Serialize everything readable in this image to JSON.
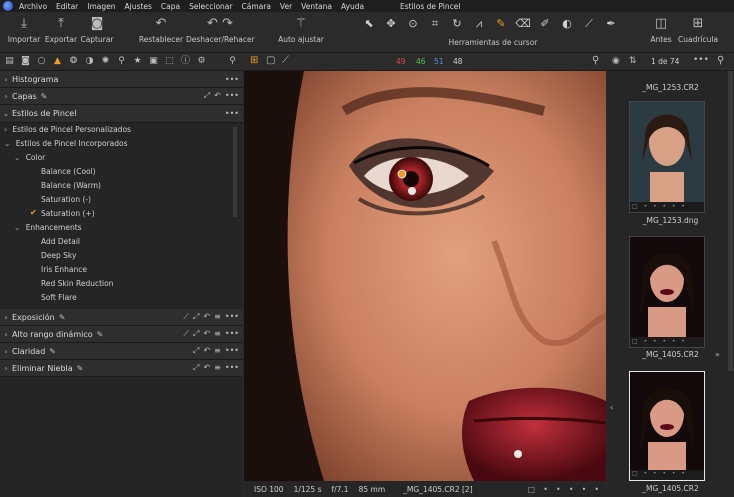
{
  "menubar": {
    "items": [
      "Archivo",
      "Editar",
      "Imagen",
      "Ajustes",
      "Capa",
      "Seleccionar",
      "Cámara",
      "Ver",
      "Ventana",
      "Ayuda"
    ],
    "window_title": "Estilos de Pincel"
  },
  "toolbar": {
    "importar": "Importar",
    "exportar": "Exportar",
    "capturar": "Capturar",
    "restablecer": "Restablecer",
    "deshacer": "Deshacer/Rehacer",
    "auto": "Auto ajustar",
    "cursor_tools": "Herramientas de cursor",
    "antes": "Antes",
    "cuadricula": "Cuadrícula"
  },
  "left_panel": {
    "histograma": "Histograma",
    "capas": "Capas",
    "estilos_pincel": "Estilos de Pincel",
    "personalizados": "Estilos de Pincel Personalizados",
    "incorporados": "Estilos de Pincel Incorporados",
    "color": "Color",
    "color_items": [
      "Balance (Cool)",
      "Balance (Warm)",
      "Saturation (-)",
      "Saturation (+)"
    ],
    "enhancements": "Enhancements",
    "enh_items": [
      "Add Detail",
      "Deep Sky",
      "Iris Enhance",
      "Red Skin Reduction",
      "Soft Flare"
    ],
    "exposicion": "Exposición",
    "alto_rango": "Alto rango dinámico",
    "claridad": "Claridad",
    "eliminar_niebla": "Eliminar Niebla"
  },
  "center": {
    "counts": [
      "49",
      "46",
      "51",
      "48"
    ],
    "count_colors": [
      "#e04848",
      "#4ec44e",
      "#4f8fe8",
      "#d0d0d0"
    ]
  },
  "status": {
    "iso": "ISO 100",
    "shutter": "1/125 s",
    "aperture": "f/7.1",
    "focal": "85 mm",
    "filename": "_MG_1405.CR2 [2]"
  },
  "browser": {
    "counter": "1 de 74",
    "thumbs": [
      "_MG_1253.CR2",
      "_MG_1253.dng",
      "_MG_1405.CR2",
      "_MG_1405.CR2"
    ]
  },
  "colors": {
    "accent": "#f09a2a"
  }
}
